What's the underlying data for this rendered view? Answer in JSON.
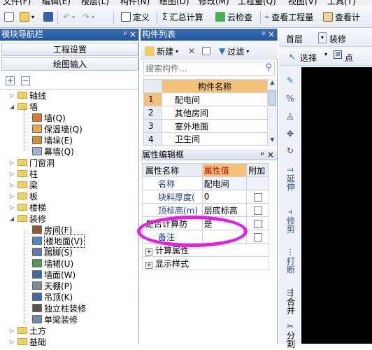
{
  "menubar": {
    "items": [
      "文件(F)",
      "编辑(E)",
      "楼层(L)",
      "构件(N)",
      "绘图(D)",
      "修改(M)",
      "工程量(Q)",
      "视图(V)",
      "工具(T)"
    ]
  },
  "toolbar": {
    "define": "定义",
    "summary": "汇总计算",
    "cloud_check": "云检查",
    "view_qty": "查看工程量",
    "view_calc": "查看计"
  },
  "nav": {
    "title": "模块导航栏",
    "pin": "ᵖ",
    "close": "×",
    "btn_project": "工程设置",
    "btn_draw": "绘图输入",
    "tree": [
      {
        "label": "轴线",
        "level": 0,
        "expanded": false
      },
      {
        "label": "墙",
        "level": 0,
        "expanded": true
      },
      {
        "label": "墙(Q)",
        "level": 1
      },
      {
        "label": "保温墙(Q)",
        "level": 1
      },
      {
        "label": "墙垛(E)",
        "level": 1
      },
      {
        "label": "幕墙(Q)",
        "level": 1
      },
      {
        "label": "门窗洞",
        "level": 0,
        "expanded": false
      },
      {
        "label": "柱",
        "level": 0,
        "expanded": false
      },
      {
        "label": "梁",
        "level": 0,
        "expanded": false
      },
      {
        "label": "板",
        "level": 0,
        "expanded": false
      },
      {
        "label": "楼梯",
        "level": 0,
        "expanded": false
      },
      {
        "label": "装修",
        "level": 0,
        "expanded": true
      },
      {
        "label": "房间(F)",
        "level": 1
      },
      {
        "label": "楼地面(V)",
        "level": 1,
        "selected": true
      },
      {
        "label": "踢脚(S)",
        "level": 1
      },
      {
        "label": "墙裙(U)",
        "level": 1
      },
      {
        "label": "墙面(W)",
        "level": 1
      },
      {
        "label": "天棚(P)",
        "level": 1
      },
      {
        "label": "吊顶(K)",
        "level": 1
      },
      {
        "label": "独立柱装修",
        "level": 1
      },
      {
        "label": "单梁装修",
        "level": 1
      },
      {
        "label": "土方",
        "level": 0,
        "expanded": false
      },
      {
        "label": "基础",
        "level": 0,
        "expanded": false
      }
    ]
  },
  "complist": {
    "title": "构件列表",
    "new": "新建",
    "filter": "过滤",
    "search_placeholder": "搜索构件...",
    "header": "构件名称",
    "rows": [
      {
        "num": "1",
        "name": "配电间"
      },
      {
        "num": "2",
        "name": "其他房间"
      },
      {
        "num": "3",
        "name": "室外地面"
      },
      {
        "num": "4",
        "name": "卫生间"
      }
    ]
  },
  "props": {
    "title": "属性编辑框",
    "col_name": "属性名称",
    "col_value": "属性值",
    "col_attach": "附加",
    "rows": [
      {
        "name": "名称",
        "value": "配电间"
      },
      {
        "name": "块料厚度(",
        "value": "0"
      },
      {
        "name": "顶标高(m)",
        "value": "层底标高"
      },
      {
        "name": "是否计算防",
        "value": "是"
      },
      {
        "name": "备注",
        "value": ""
      }
    ],
    "groups": [
      "计算属性",
      "显示样式"
    ]
  },
  "right": {
    "floor": "首层",
    "category": "装修",
    "select": "选择",
    "point": "点",
    "vtools": [
      "延伸",
      "修剪",
      "打断",
      "合并",
      "分割"
    ]
  },
  "colors": {
    "header_blue": "#24549e",
    "highlight": "#e61fe6",
    "prop_value_bg": "#f2c27a"
  }
}
